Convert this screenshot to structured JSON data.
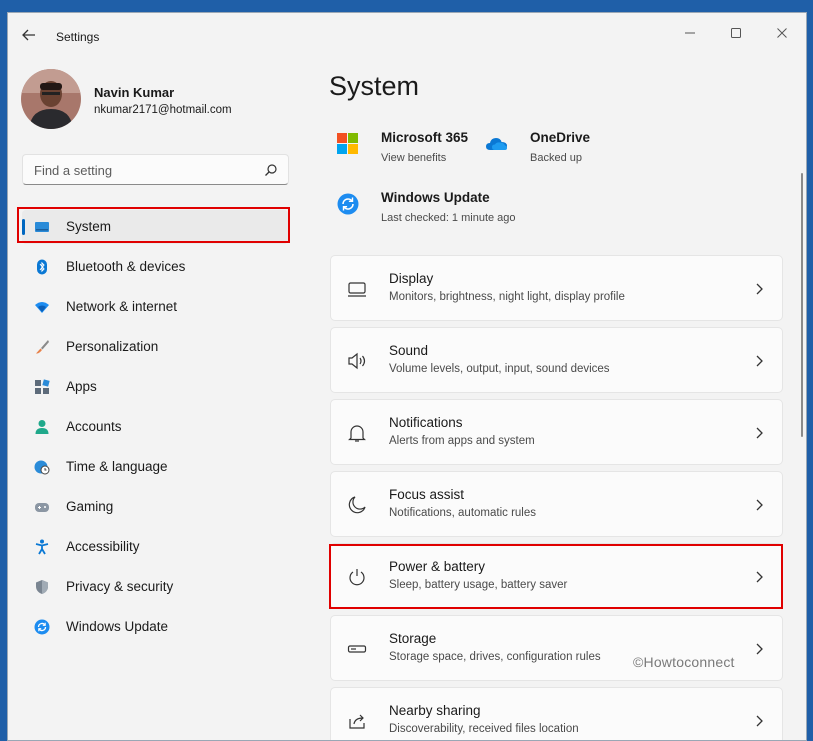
{
  "app": {
    "title": "Settings"
  },
  "user": {
    "name": "Navin Kumar",
    "email": "nkumar2171@hotmail.com"
  },
  "search": {
    "placeholder": "Find a setting"
  },
  "nav": {
    "items": [
      {
        "label": "System",
        "icon": "system-icon",
        "active": true
      },
      {
        "label": "Bluetooth & devices",
        "icon": "bluetooth-icon"
      },
      {
        "label": "Network & internet",
        "icon": "wifi-icon"
      },
      {
        "label": "Personalization",
        "icon": "brush-icon"
      },
      {
        "label": "Apps",
        "icon": "apps-icon"
      },
      {
        "label": "Accounts",
        "icon": "person-icon"
      },
      {
        "label": "Time & language",
        "icon": "clock-globe-icon"
      },
      {
        "label": "Gaming",
        "icon": "gamepad-icon"
      },
      {
        "label": "Accessibility",
        "icon": "accessibility-icon"
      },
      {
        "label": "Privacy & security",
        "icon": "shield-icon"
      },
      {
        "label": "Windows Update",
        "icon": "update-icon"
      }
    ]
  },
  "main": {
    "title": "System",
    "quick": [
      {
        "title": "Microsoft 365",
        "sub": "View benefits",
        "icon": "microsoft-logo-icon"
      },
      {
        "title": "OneDrive",
        "sub": "Backed up",
        "icon": "cloud-icon"
      },
      {
        "title": "Windows Update",
        "sub": "Last checked: 1 minute ago",
        "icon": "update-icon"
      }
    ],
    "cards": [
      {
        "title": "Display",
        "sub": "Monitors, brightness, night light, display profile",
        "icon": "monitor-icon"
      },
      {
        "title": "Sound",
        "sub": "Volume levels, output, input, sound devices",
        "icon": "speaker-icon"
      },
      {
        "title": "Notifications",
        "sub": "Alerts from apps and system",
        "icon": "bell-icon"
      },
      {
        "title": "Focus assist",
        "sub": "Notifications, automatic rules",
        "icon": "moon-icon"
      },
      {
        "title": "Power & battery",
        "sub": "Sleep, battery usage, battery saver",
        "icon": "power-icon"
      },
      {
        "title": "Storage",
        "sub": "Storage space, drives, configuration rules",
        "icon": "drive-icon"
      },
      {
        "title": "Nearby sharing",
        "sub": "Discoverability, received files location",
        "icon": "share-icon"
      }
    ]
  },
  "watermark": "©Howtoconnect",
  "colors": {
    "accent": "#0067c0",
    "highlight": "#e00000",
    "background": "#f3f3f3"
  }
}
